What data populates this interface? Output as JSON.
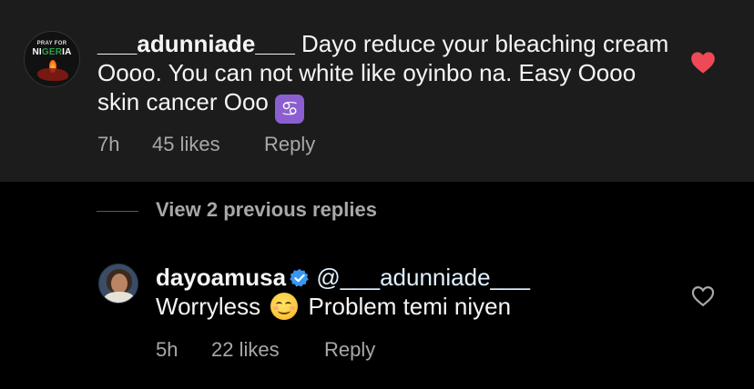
{
  "comment": {
    "avatar": {
      "line1": "PRAY FOR",
      "line2a": "NI",
      "line2b": "GER",
      "line2c": "IA"
    },
    "username": "___adunniade___",
    "text_part1": " Dayo reduce your bleaching cream Oooo. You can not white like oyinbo na. Easy Oooo skin cancer Ooo ",
    "emoji": "♋",
    "emoji_icon": "cancer-zodiac-icon",
    "time": "7h",
    "likes": "45 likes",
    "reply_label": "Reply",
    "liked": true,
    "heart_color": "#ed4956"
  },
  "view_replies": "View 2 previous replies",
  "reply": {
    "username": "dayoamusa",
    "verified": true,
    "verified_color": "#3897f0",
    "mention": "@___adunniade___",
    "text_before": "Worryless ",
    "emoji_icon": "smiling-face-icon",
    "text_after": " Problem temi niyen",
    "time": "5h",
    "likes": "22 likes",
    "reply_label": "Reply",
    "liked": false
  }
}
